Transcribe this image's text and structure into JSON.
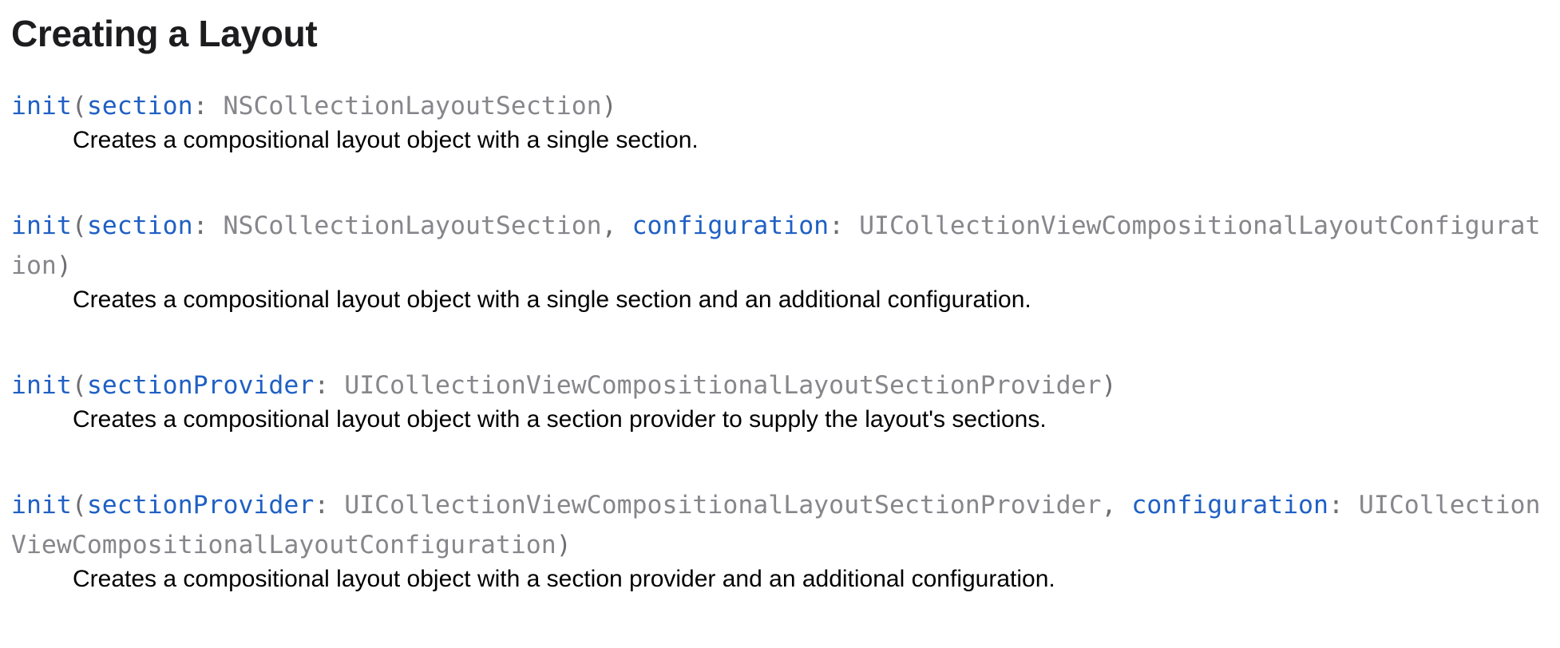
{
  "title": "Creating a Layout",
  "symbols": [
    {
      "parts": [
        {
          "t": "init",
          "c": "kw"
        },
        {
          "t": "(",
          "c": "punct"
        },
        {
          "t": "section",
          "c": "param"
        },
        {
          "t": ": ",
          "c": "punct"
        },
        {
          "t": "NSCollectionLayoutSection",
          "c": "type"
        },
        {
          "t": ")",
          "c": "punct"
        }
      ],
      "abstract": "Creates a compositional layout object with a single section."
    },
    {
      "parts": [
        {
          "t": "init",
          "c": "kw"
        },
        {
          "t": "(",
          "c": "punct"
        },
        {
          "t": "section",
          "c": "param"
        },
        {
          "t": ": ",
          "c": "punct"
        },
        {
          "t": "NSCollectionLayoutSection",
          "c": "type"
        },
        {
          "t": ", ",
          "c": "punct"
        },
        {
          "t": "configuration",
          "c": "param"
        },
        {
          "t": ": ",
          "c": "punct"
        },
        {
          "t": "UICollectionViewCompositionalLayoutConfiguration",
          "c": "type"
        },
        {
          "t": ")",
          "c": "punct"
        }
      ],
      "abstract": "Creates a compositional layout object with a single section and an additional configuration."
    },
    {
      "parts": [
        {
          "t": "init",
          "c": "kw"
        },
        {
          "t": "(",
          "c": "punct"
        },
        {
          "t": "sectionProvider",
          "c": "param"
        },
        {
          "t": ": ",
          "c": "punct"
        },
        {
          "t": "UICollectionViewCompositionalLayoutSectionProvider",
          "c": "type"
        },
        {
          "t": ")",
          "c": "punct"
        }
      ],
      "abstract": "Creates a compositional layout object with a section provider to supply the layout's sections."
    },
    {
      "parts": [
        {
          "t": "init",
          "c": "kw"
        },
        {
          "t": "(",
          "c": "punct"
        },
        {
          "t": "sectionProvider",
          "c": "param"
        },
        {
          "t": ": ",
          "c": "punct"
        },
        {
          "t": "UICollectionViewCompositionalLayoutSectionProvider",
          "c": "type"
        },
        {
          "t": ", ",
          "c": "punct"
        },
        {
          "t": "configuration",
          "c": "param"
        },
        {
          "t": ": ",
          "c": "punct"
        },
        {
          "t": "UICollectionViewCompositionalLayoutConfiguration",
          "c": "type"
        },
        {
          "t": ")",
          "c": "punct"
        }
      ],
      "abstract": "Creates a compositional layout object with a section provider and an additional configuration."
    }
  ],
  "colors": {
    "keyword": "#1f60c4",
    "type": "#86868b",
    "text": "#000000",
    "heading": "#1d1d1f"
  }
}
